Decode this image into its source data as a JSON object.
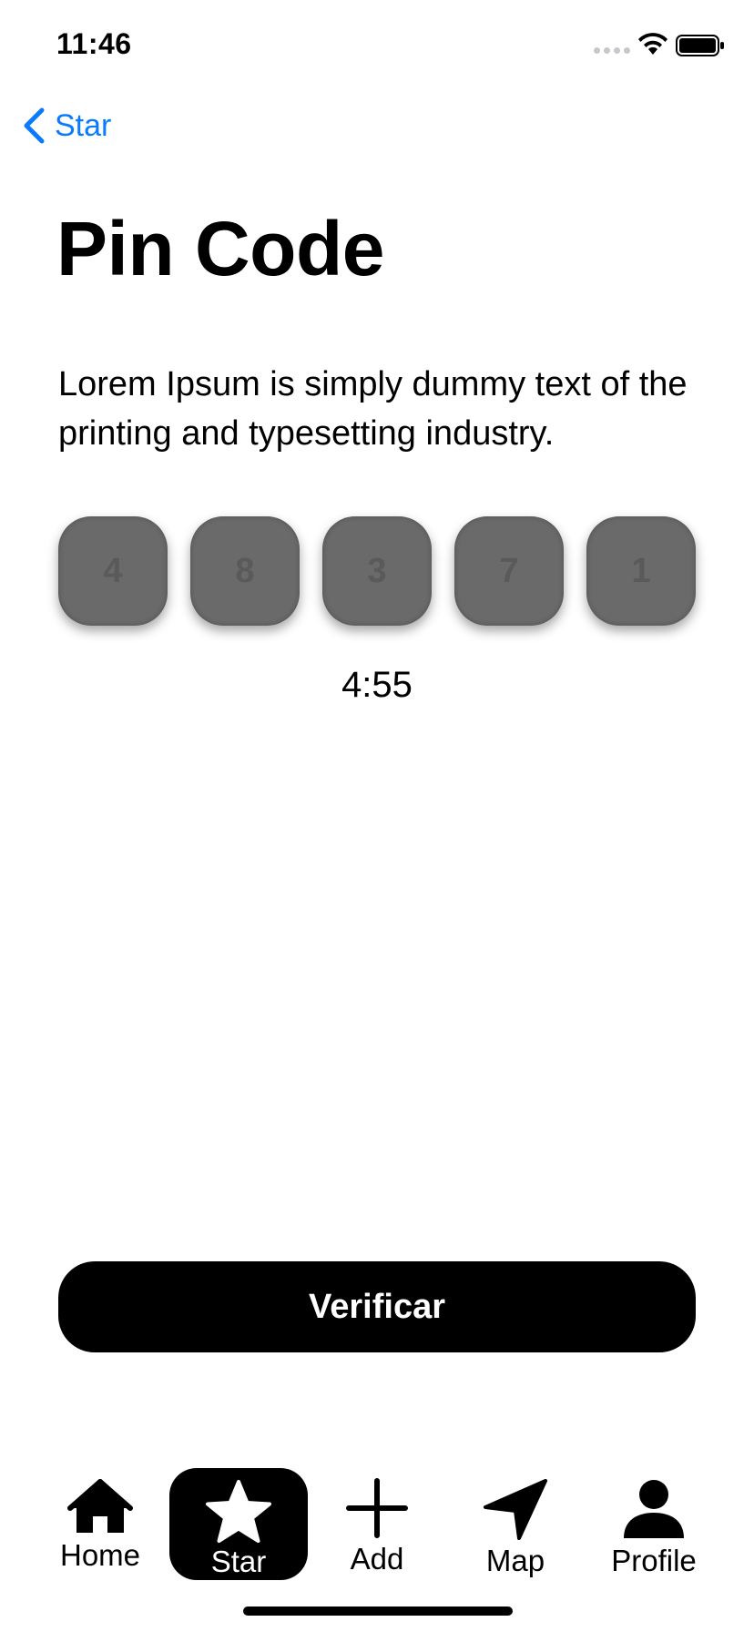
{
  "status_bar": {
    "time": "11:46"
  },
  "nav": {
    "back_label": "Star"
  },
  "page": {
    "title": "Pin Code",
    "description": "Lorem Ipsum is simply dummy text of the printing and typesetting industry."
  },
  "pin": {
    "digits": [
      "4",
      "8",
      "3",
      "7",
      "1"
    ],
    "timer": "4:55"
  },
  "actions": {
    "verify_label": "Verificar"
  },
  "tabbar": {
    "items": [
      {
        "label": "Home",
        "icon": "house-icon"
      },
      {
        "label": "Star",
        "icon": "star-icon",
        "active": true
      },
      {
        "label": "Add",
        "icon": "plus-icon"
      },
      {
        "label": "Map",
        "icon": "location-arrow-icon"
      },
      {
        "label": "Profile",
        "icon": "person-icon"
      }
    ]
  },
  "colors": {
    "accent": "#0a7aff",
    "primary": "#000000",
    "pin_box": "#6a6a6a"
  }
}
